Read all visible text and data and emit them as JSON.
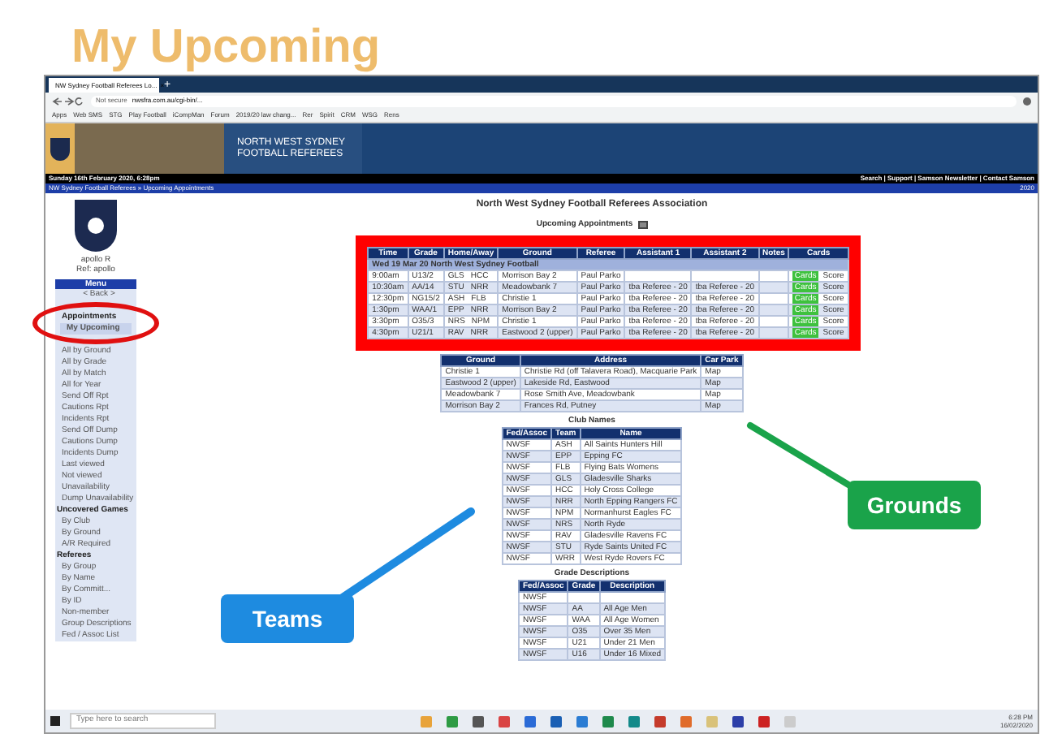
{
  "page_title": "My Upcoming",
  "browser": {
    "tab_title": "NW Sydney Football Referees Lo...",
    "tab_close": "×",
    "new_tab": "+",
    "security": "Not secure",
    "url": "nwsfra.com.au/cgi-bin/...",
    "bookmarks": [
      "Apps",
      "Web SMS",
      "STG",
      "Play Football",
      "iCompMan",
      "Forum",
      "2019/20 law chang...",
      "Rer",
      "Spirit",
      "CRM",
      "WSG",
      "Rens"
    ]
  },
  "site": {
    "banner_lines": [
      "NORTH WEST SYDNEY",
      "FOOTBALL REFEREES"
    ],
    "date": "Sunday 16th February 2020, 6:28pm",
    "top_links": "Search | Support | Samson Newsletter | Contact Samson",
    "breadcrumb": "NW Sydney Football Referees » Upcoming Appointments",
    "year": "2020"
  },
  "sidebar": {
    "user": "apollo R",
    "ref": "Ref: apollo",
    "menu_title": "Menu",
    "items": [
      {
        "label": "< Back >",
        "kind": "link",
        "selected": false,
        "circled": false
      },
      {
        "label": "Appointments",
        "kind": "heading",
        "selected": false,
        "circled": true
      },
      {
        "label": "My Upcoming",
        "kind": "link",
        "selected": true,
        "circled": true
      },
      {
        "label": "All by Ground",
        "kind": "link",
        "selected": false,
        "circled": false
      },
      {
        "label": "All by Grade",
        "kind": "link",
        "selected": false,
        "circled": false
      },
      {
        "label": "All by Match",
        "kind": "link",
        "selected": false,
        "circled": false
      },
      {
        "label": "All for Year",
        "kind": "link",
        "selected": false,
        "circled": false
      },
      {
        "label": "Send Off Rpt",
        "kind": "link",
        "selected": false,
        "circled": false
      },
      {
        "label": "Cautions Rpt",
        "kind": "link",
        "selected": false,
        "circled": false
      },
      {
        "label": "Incidents Rpt",
        "kind": "link",
        "selected": false,
        "circled": false
      },
      {
        "label": "Send Off Dump",
        "kind": "link",
        "selected": false,
        "circled": false
      },
      {
        "label": "Cautions Dump",
        "kind": "link",
        "selected": false,
        "circled": false
      },
      {
        "label": "Incidents Dump",
        "kind": "link",
        "selected": false,
        "circled": false
      },
      {
        "label": "Last viewed",
        "kind": "link",
        "selected": false,
        "circled": false
      },
      {
        "label": "Not viewed",
        "kind": "link",
        "selected": false,
        "circled": false
      },
      {
        "label": "Unavailability",
        "kind": "link",
        "selected": false,
        "circled": false
      },
      {
        "label": "Dump Unavailability",
        "kind": "link",
        "selected": false,
        "circled": false
      },
      {
        "label": "Uncovered Games",
        "kind": "heading",
        "selected": false,
        "circled": false
      },
      {
        "label": "By Club",
        "kind": "link",
        "selected": false,
        "circled": false
      },
      {
        "label": "By Ground",
        "kind": "link",
        "selected": false,
        "circled": false
      },
      {
        "label": "A/R Required",
        "kind": "link",
        "selected": false,
        "circled": false
      },
      {
        "label": "Referees",
        "kind": "heading",
        "selected": false,
        "circled": false
      },
      {
        "label": "By Group",
        "kind": "link",
        "selected": false,
        "circled": false
      },
      {
        "label": "By Name",
        "kind": "link",
        "selected": false,
        "circled": false
      },
      {
        "label": "By Committ...",
        "kind": "link",
        "selected": false,
        "circled": false
      },
      {
        "label": "By ID",
        "kind": "link",
        "selected": false,
        "circled": false
      },
      {
        "label": "Non-member",
        "kind": "link",
        "selected": false,
        "circled": false
      },
      {
        "label": "Group Descriptions",
        "kind": "link",
        "selected": false,
        "circled": false
      },
      {
        "label": "Fed / Assoc List",
        "kind": "link",
        "selected": false,
        "circled": false
      }
    ]
  },
  "content": {
    "org": "North West Sydney Football Referees Association",
    "title": "Upcoming Appointments",
    "appointments": {
      "columns": [
        "Time",
        "Grade",
        "Home/Away",
        "Ground",
        "Referee",
        "Assistant 1",
        "Assistant 2",
        "Notes",
        "Cards"
      ],
      "group": "Wed 19 Mar 20   North West Sydney Football",
      "rows": [
        {
          "time": "9:00am",
          "grade": "U13/2",
          "home": "GLS",
          "away": "HCC",
          "ground": "Morrison Bay 2",
          "referee": "Paul Parko",
          "cards": "Cards",
          "score": "Score"
        },
        {
          "time": "10:30am",
          "grade": "AA/14",
          "home": "STU",
          "away": "NRR",
          "ground": "Meadowbank 7",
          "referee": "Paul Parko",
          "assistant_1": "tba Referee - 20",
          "assistant_2": "tba Referee - 20",
          "cards": "Cards",
          "score": "Score"
        },
        {
          "time": "12:30pm",
          "grade": "NG15/2",
          "home": "ASH",
          "away": "FLB",
          "ground": "Christie 1",
          "referee": "Paul Parko",
          "assistant_1": "tba Referee - 20",
          "assistant_2": "tba Referee - 20",
          "cards": "Cards",
          "score": "Score"
        },
        {
          "time": "1:30pm",
          "grade": "WAA/1",
          "home": "EPP",
          "away": "NRR",
          "ground": "Morrison Bay 2",
          "referee": "Paul Parko",
          "assistant_1": "tba Referee - 20",
          "assistant_2": "tba Referee - 20",
          "cards": "Cards",
          "score": "Score"
        },
        {
          "time": "3:30pm",
          "grade": "O35/3",
          "home": "NRS",
          "away": "NPM",
          "ground": "Christie 1",
          "referee": "Paul Parko",
          "assistant_1": "tba Referee - 20",
          "assistant_2": "tba Referee - 20",
          "cards": "Cards",
          "score": "Score"
        },
        {
          "time": "4:30pm",
          "grade": "U21/1",
          "home": "RAV",
          "away": "NRR",
          "ground": "Eastwood 2 (upper)",
          "referee": "Paul Parko",
          "assistant_1": "tba Referee - 20",
          "assistant_2": "tba Referee - 20",
          "cards": "Cards",
          "score": "Score"
        }
      ]
    },
    "grounds": {
      "columns": [
        "Ground",
        "Address",
        "Car Park"
      ],
      "rows": [
        [
          "Christie 1",
          "Christie Rd (off Talavera Road), Macquarie Park",
          "Map"
        ],
        [
          "Eastwood 2 (upper)",
          "Lakeside Rd, Eastwood",
          "Map"
        ],
        [
          "Meadowbank 7",
          "Rose Smith Ave, Meadowbank",
          "Map"
        ],
        [
          "Morrison Bay 2",
          "Frances Rd, Putney",
          "Map"
        ]
      ]
    },
    "clubs": {
      "title": "Club Names",
      "columns": [
        "Fed/Assoc",
        "Team",
        "Name"
      ],
      "rows": [
        [
          "NWSF",
          "ASH",
          "All Saints Hunters Hill"
        ],
        [
          "NWSF",
          "EPP",
          "Epping FC"
        ],
        [
          "NWSF",
          "FLB",
          "Flying Bats Womens"
        ],
        [
          "NWSF",
          "GLS",
          "Gladesville Sharks"
        ],
        [
          "NWSF",
          "HCC",
          "Holy Cross College"
        ],
        [
          "NWSF",
          "NRR",
          "North Epping Rangers FC"
        ],
        [
          "NWSF",
          "NPM",
          "Normanhurst Eagles FC"
        ],
        [
          "NWSF",
          "NRS",
          "North Ryde"
        ],
        [
          "NWSF",
          "RAV",
          "Gladesville Ravens FC"
        ],
        [
          "NWSF",
          "STU",
          "Ryde Saints United FC"
        ],
        [
          "NWSF",
          "WRR",
          "West Ryde Rovers FC"
        ]
      ]
    },
    "grades": {
      "title": "Grade Descriptions",
      "columns": [
        "Fed/Assoc",
        "Grade",
        "Description"
      ],
      "rows": [
        [
          "NWSF"
        ],
        [
          "NWSF",
          "AA",
          "All Age Men"
        ],
        [
          "NWSF",
          "WAA",
          "All Age Women"
        ],
        [
          "NWSF",
          "O35",
          "Over 35 Men"
        ],
        [
          "NWSF",
          "U21",
          "Under 21 Men"
        ],
        [
          "NWSF",
          "U16",
          "Under 16 Mixed"
        ]
      ]
    }
  },
  "callouts": [
    {
      "text": "Grounds",
      "color": "#1aa34a"
    },
    {
      "text": "Teams",
      "color": "#1e8be0"
    }
  ],
  "taskbar": {
    "search_placeholder": "Type here to search",
    "time": "6:28 PM",
    "date": "16/02/2020"
  }
}
